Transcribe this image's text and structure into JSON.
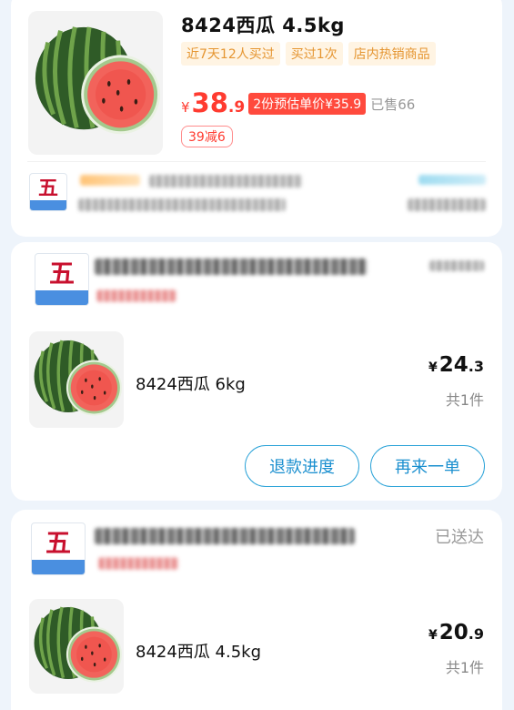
{
  "featured": {
    "title": "8424西瓜 4.5kg",
    "tags": [
      "近7天12人买过",
      "买过1次",
      "店内热销商品"
    ],
    "price": {
      "currency": "¥",
      "integer": "38",
      "decimal": ".9"
    },
    "estimate_badge": "2份预估单价¥35.9",
    "sold": "已售66",
    "coupon": "39减6",
    "image_icon": "watermelon-icon"
  },
  "orders": [
    {
      "status": "",
      "item_name": "8424西瓜 6kg",
      "price": {
        "currency": "¥",
        "integer": "24",
        "decimal": ".3"
      },
      "count": "共1件",
      "buttons": [
        "退款进度",
        "再来一单"
      ]
    },
    {
      "status": "已送达",
      "item_name": "8424西瓜 4.5kg",
      "price": {
        "currency": "¥",
        "integer": "20",
        "decimal": ".9"
      },
      "count": "共1件"
    }
  ],
  "colors": {
    "accent_red": "#ff3b30",
    "tag_orange": "#e59530",
    "button_blue": "#1a8fcf",
    "background": "#eef4fb"
  }
}
